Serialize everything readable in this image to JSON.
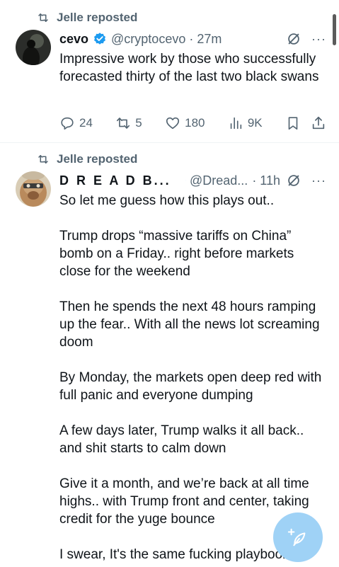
{
  "tweets": [
    {
      "repost_label": "Jelle reposted",
      "name": "cevo",
      "handle": "@cryptocevo",
      "time": "· 27m",
      "text": "Impressive work by those who successfully forecasted thirty of the last two black swans",
      "more": "···",
      "stats": {
        "replies": "24",
        "reposts": "5",
        "likes": "180",
        "views": "9K"
      }
    },
    {
      "repost_label": "Jelle reposted",
      "name": "D R E A D  B...",
      "handle": "@Dread...",
      "time": "· 11h",
      "more": "···",
      "text": "So let me guess how this plays out..\n\nTrump drops “massive tariffs on China” bomb on a Friday.. right before markets close for the weekend\n\nThen he spends the next 48 hours ramping up the fear.. With all the news lot screaming doom\n\nBy Monday, the markets open deep red with full panic and everyone dumping\n\nA few days later, Trump walks it all back.. and shit starts to calm down\n\nGive it a month, and we’re back at all time highs.. with Trump front and center, taking credit for the yuge bounce\n\nI swear, It's the same fucking playbook.."
    }
  ],
  "colors": {
    "verified": "#1d9bf0",
    "muted": "#536471",
    "fab": "#9fd2f6"
  },
  "icons": [
    "repost-icon",
    "verified-icon",
    "grok-icon",
    "more-icon",
    "reply-icon",
    "like-icon",
    "views-icon",
    "bookmark-icon",
    "share-icon",
    "compose-icon"
  ]
}
